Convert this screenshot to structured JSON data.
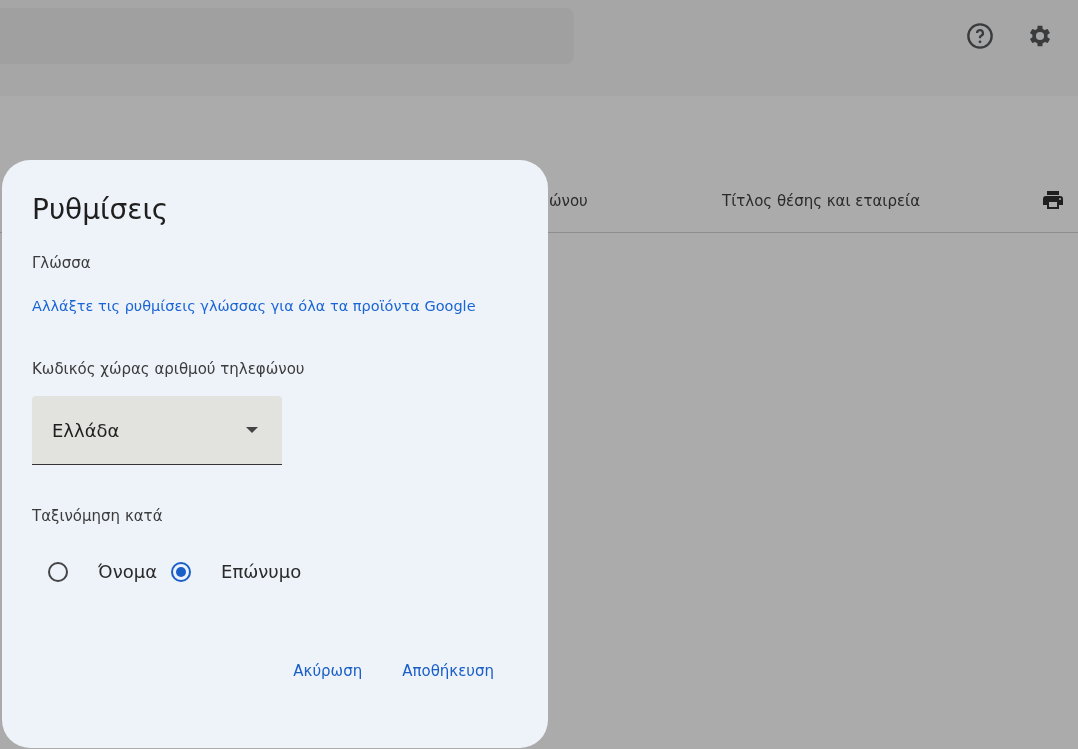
{
  "background": {
    "table_headers": [
      "ώνου",
      "Τίτλος θέσης και εταιρεία"
    ]
  },
  "dialog": {
    "title": "Ρυθμίσεις",
    "language": {
      "label": "Γλώσσα",
      "link": "Αλλάξτε τις ρυθμίσεις γλώσσας για όλα τα προϊόντα Google"
    },
    "phone_country": {
      "label": "Κωδικός χώρας αριθμού τηλεφώνου",
      "value": "Ελλάδα"
    },
    "sort": {
      "label": "Ταξινόμηση κατά",
      "options": [
        {
          "label": "Όνομα",
          "selected": false
        },
        {
          "label": "Επώνυμο",
          "selected": true
        }
      ]
    },
    "buttons": [
      "Ακύρωση",
      "Αποθήκευση"
    ]
  }
}
